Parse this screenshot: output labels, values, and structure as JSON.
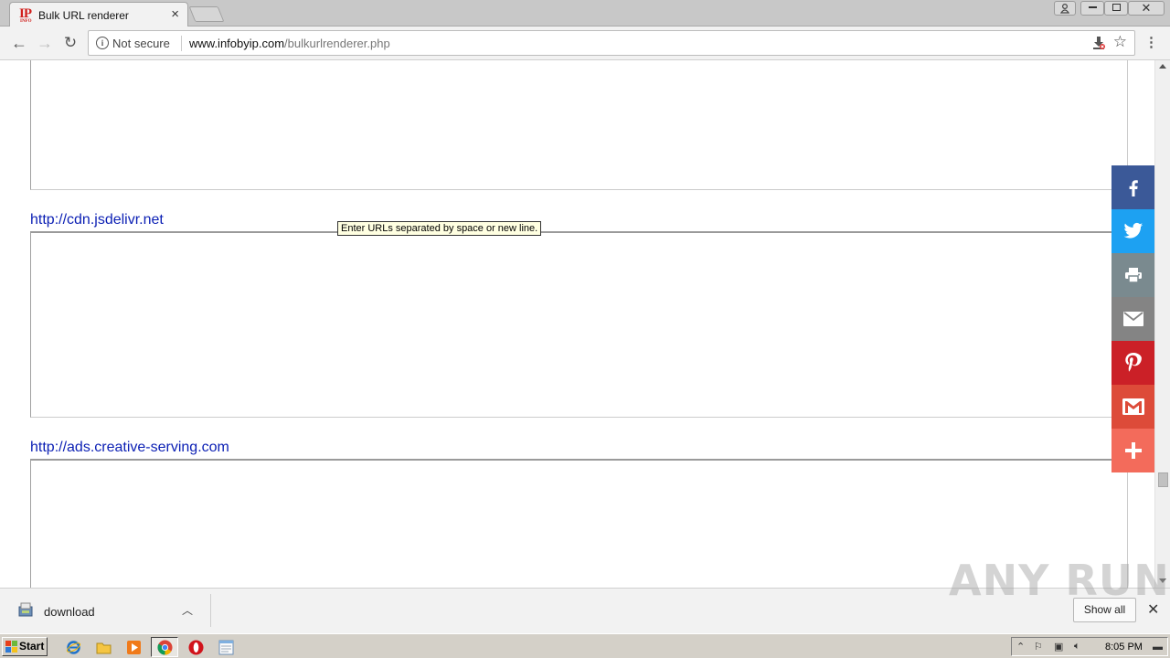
{
  "browser": {
    "tab": {
      "title": "Bulk URL renderer",
      "favicon_text": "IP",
      "favicon_sub": "INFO"
    },
    "window_buttons": [
      "user-icon",
      "minimize",
      "maximize",
      "close"
    ],
    "address": {
      "security_label": "Not secure",
      "host": "www.infobyip.com",
      "path": "/bulkurlrenderer.php"
    }
  },
  "page": {
    "tooltip": "Enter URLs separated by space or new line.",
    "sites": [
      {
        "url": "http://cdn.jsdelivr.net"
      },
      {
        "url": "http://ads.creative-serving.com"
      }
    ],
    "share": [
      {
        "name": "facebook",
        "color": "#3b5998"
      },
      {
        "name": "twitter",
        "color": "#1da1f2"
      },
      {
        "name": "print",
        "color": "#7a8a8f"
      },
      {
        "name": "email",
        "color": "#848484"
      },
      {
        "name": "pinterest",
        "color": "#cb2027"
      },
      {
        "name": "gmail",
        "color": "#dd4b39"
      },
      {
        "name": "more",
        "color": "#f36b5b"
      }
    ]
  },
  "download_shelf": {
    "file_name": "download",
    "show_all_label": "Show all",
    "watermark": "ANY RUN"
  },
  "taskbar": {
    "start_label": "Start",
    "clock": "8:05 PM"
  }
}
